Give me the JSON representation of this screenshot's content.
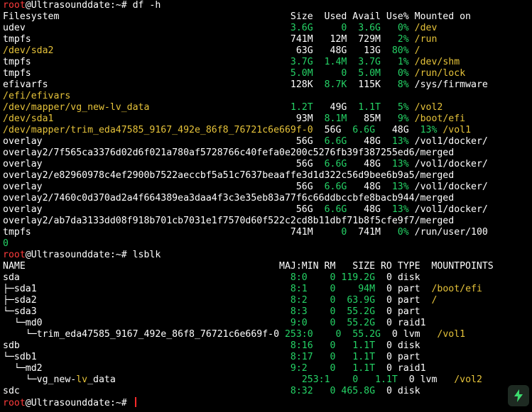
{
  "colors": {
    "default": "#ffffff",
    "user": "#ff3b3b",
    "host": "#ffffff",
    "green": "#25d366",
    "yellow": "#e6c33a",
    "cursor": "#ff2a2a",
    "badge_icon": "#3ddc6e"
  },
  "icons": {
    "bolt": "lightning-bolt-icon"
  },
  "lines": [
    [
      {
        "t": "root",
        "c": "user"
      },
      {
        "t": "@Ultrasounddate:~# df -h",
        "c": "host"
      }
    ],
    [
      {
        "t": "Filesystem                                         Size  Used Avail Use% Mounted on",
        "c": "default"
      }
    ],
    [
      {
        "t": "udev                                               ",
        "c": "default"
      },
      {
        "t": "3.6G",
        "c": "green"
      },
      {
        "t": "     ",
        "c": "default"
      },
      {
        "t": "0",
        "c": "green"
      },
      {
        "t": "  ",
        "c": "default"
      },
      {
        "t": "3.6G",
        "c": "green"
      },
      {
        "t": "   ",
        "c": "default"
      },
      {
        "t": "0%",
        "c": "green"
      },
      {
        "t": " ",
        "c": "default"
      },
      {
        "t": "/dev",
        "c": "yellow"
      }
    ],
    [
      {
        "t": "tmpfs                                              741M   12M  729M   ",
        "c": "default"
      },
      {
        "t": "2%",
        "c": "green"
      },
      {
        "t": " ",
        "c": "default"
      },
      {
        "t": "/run",
        "c": "yellow"
      }
    ],
    [
      {
        "t": "/dev/sda2",
        "c": "yellow"
      },
      {
        "t": "                                           63G   48G   13G  ",
        "c": "default"
      },
      {
        "t": "80%",
        "c": "green"
      },
      {
        "t": " ",
        "c": "default"
      },
      {
        "t": "/",
        "c": "yellow"
      }
    ],
    [
      {
        "t": "tmpfs                                              ",
        "c": "default"
      },
      {
        "t": "3.7G",
        "c": "green"
      },
      {
        "t": "  ",
        "c": "default"
      },
      {
        "t": "1.4M",
        "c": "green"
      },
      {
        "t": "  ",
        "c": "default"
      },
      {
        "t": "3.7G",
        "c": "green"
      },
      {
        "t": "   ",
        "c": "default"
      },
      {
        "t": "1%",
        "c": "green"
      },
      {
        "t": " ",
        "c": "default"
      },
      {
        "t": "/dev/shm",
        "c": "yellow"
      }
    ],
    [
      {
        "t": "tmpfs                                              ",
        "c": "default"
      },
      {
        "t": "5.0M",
        "c": "green"
      },
      {
        "t": "     ",
        "c": "default"
      },
      {
        "t": "0",
        "c": "green"
      },
      {
        "t": "  ",
        "c": "default"
      },
      {
        "t": "5.0M",
        "c": "green"
      },
      {
        "t": "   ",
        "c": "default"
      },
      {
        "t": "0%",
        "c": "green"
      },
      {
        "t": " ",
        "c": "default"
      },
      {
        "t": "/run/lock",
        "c": "yellow"
      }
    ],
    [
      {
        "t": "efivarfs                                           128K  ",
        "c": "default"
      },
      {
        "t": "8.7K",
        "c": "green"
      },
      {
        "t": "  115K   ",
        "c": "default"
      },
      {
        "t": "8%",
        "c": "green"
      },
      {
        "t": " /sys/firmware",
        "c": "default"
      }
    ],
    [
      {
        "t": "/efi/efivars",
        "c": "yellow"
      }
    ],
    [
      {
        "t": "/dev/mapper/vg_new-lv_data",
        "c": "yellow"
      },
      {
        "t": "                         ",
        "c": "default"
      },
      {
        "t": "1.2T",
        "c": "green"
      },
      {
        "t": "   49G  ",
        "c": "default"
      },
      {
        "t": "1.1T",
        "c": "green"
      },
      {
        "t": "   ",
        "c": "default"
      },
      {
        "t": "5%",
        "c": "green"
      },
      {
        "t": " ",
        "c": "default"
      },
      {
        "t": "/vol2",
        "c": "yellow"
      }
    ],
    [
      {
        "t": "/dev/sda1",
        "c": "yellow"
      },
      {
        "t": "                                           93M  ",
        "c": "default"
      },
      {
        "t": "8.1M",
        "c": "green"
      },
      {
        "t": "   85M   ",
        "c": "default"
      },
      {
        "t": "9%",
        "c": "green"
      },
      {
        "t": " ",
        "c": "default"
      },
      {
        "t": "/boot/efi",
        "c": "yellow"
      }
    ],
    [
      {
        "t": "/dev/mapper/trim_eda47585_9167_492e_86f8_76721c6e669f-0",
        "c": "yellow"
      },
      {
        "t": "  56G  ",
        "c": "default"
      },
      {
        "t": "6.6G",
        "c": "green"
      },
      {
        "t": "   48G  ",
        "c": "default"
      },
      {
        "t": "13%",
        "c": "green"
      },
      {
        "t": " ",
        "c": "default"
      },
      {
        "t": "/vol1",
        "c": "yellow"
      }
    ],
    [
      {
        "t": "overlay                                             56G  ",
        "c": "default"
      },
      {
        "t": "6.6G",
        "c": "green"
      },
      {
        "t": "   48G  ",
        "c": "default"
      },
      {
        "t": "13%",
        "c": "green"
      },
      {
        "t": " /vol1/docker/",
        "c": "default"
      }
    ],
    [
      {
        "t": "overlay2/7f565ca3376d02d6f021a780af5728766c40fefa0e200c5276fb39f387255ed6/merged",
        "c": "default"
      }
    ],
    [
      {
        "t": "overlay                                             56G  ",
        "c": "default"
      },
      {
        "t": "6.6G",
        "c": "green"
      },
      {
        "t": "   48G  ",
        "c": "default"
      },
      {
        "t": "13%",
        "c": "green"
      },
      {
        "t": " /vol1/docker/",
        "c": "default"
      }
    ],
    [
      {
        "t": "overlay2/e82960978c4ef2900b7522aeccbf5a51c7637beaaffe3d1d322c56d9bee6b9a5/merged",
        "c": "default"
      }
    ],
    [
      {
        "t": "overlay                                             56G  ",
        "c": "default"
      },
      {
        "t": "6.6G",
        "c": "green"
      },
      {
        "t": "   48G  ",
        "c": "default"
      },
      {
        "t": "13%",
        "c": "green"
      },
      {
        "t": " /vol1/docker/",
        "c": "default"
      }
    ],
    [
      {
        "t": "overlay2/7460c0d370ad2a4f664389ea3daa4f3c3e35eb83a77f6c66ddbccbfe8bacb944/merged",
        "c": "default"
      }
    ],
    [
      {
        "t": "overlay                                             56G  ",
        "c": "default"
      },
      {
        "t": "6.6G",
        "c": "green"
      },
      {
        "t": "   48G  ",
        "c": "default"
      },
      {
        "t": "13%",
        "c": "green"
      },
      {
        "t": " /vol1/docker/",
        "c": "default"
      }
    ],
    [
      {
        "t": "overlay2/ab7da3133dd08f918b701cb7031e1f7570d60f522c2cd8b11dbf71b8f5cfe9f7/merged",
        "c": "default"
      }
    ],
    [
      {
        "t": "tmpfs                                              741M     ",
        "c": "default"
      },
      {
        "t": "0",
        "c": "green"
      },
      {
        "t": "  741M   ",
        "c": "default"
      },
      {
        "t": "0%",
        "c": "green"
      },
      {
        "t": " /run/user/100",
        "c": "default"
      }
    ],
    [
      {
        "t": "0",
        "c": "green"
      }
    ],
    [
      {
        "t": "root",
        "c": "user"
      },
      {
        "t": "@Ultrasounddate:~# lsblk",
        "c": "host"
      }
    ],
    [
      {
        "t": "NAME                                             MAJ:MIN RM   SIZE RO TYPE  MOUNTPOINTS",
        "c": "default"
      }
    ],
    [
      {
        "t": "sda                                                ",
        "c": "default"
      },
      {
        "t": "8:0",
        "c": "green"
      },
      {
        "t": "    ",
        "c": "default"
      },
      {
        "t": "0",
        "c": "green"
      },
      {
        "t": " ",
        "c": "default"
      },
      {
        "t": "119.2G",
        "c": "green"
      },
      {
        "t": "  0 disk",
        "c": "default"
      }
    ],
    [
      {
        "t": "├─sda1                                             ",
        "c": "default"
      },
      {
        "t": "8:1",
        "c": "green"
      },
      {
        "t": "    ",
        "c": "default"
      },
      {
        "t": "0",
        "c": "green"
      },
      {
        "t": "    ",
        "c": "default"
      },
      {
        "t": "94M",
        "c": "green"
      },
      {
        "t": "  0 part  ",
        "c": "default"
      },
      {
        "t": "/boot/efi",
        "c": "yellow"
      }
    ],
    [
      {
        "t": "├─sda2                                             ",
        "c": "default"
      },
      {
        "t": "8:2",
        "c": "green"
      },
      {
        "t": "    ",
        "c": "default"
      },
      {
        "t": "0",
        "c": "green"
      },
      {
        "t": "  ",
        "c": "default"
      },
      {
        "t": "63.9G",
        "c": "green"
      },
      {
        "t": "  0 part  ",
        "c": "default"
      },
      {
        "t": "/",
        "c": "yellow"
      }
    ],
    [
      {
        "t": "└─sda3                                             ",
        "c": "default"
      },
      {
        "t": "8:3",
        "c": "green"
      },
      {
        "t": "    ",
        "c": "default"
      },
      {
        "t": "0",
        "c": "green"
      },
      {
        "t": "  ",
        "c": "default"
      },
      {
        "t": "55.2G",
        "c": "green"
      },
      {
        "t": "  0 part",
        "c": "default"
      }
    ],
    [
      {
        "t": "  └─md0                                            ",
        "c": "default"
      },
      {
        "t": "9:0",
        "c": "green"
      },
      {
        "t": "    ",
        "c": "default"
      },
      {
        "t": "0",
        "c": "green"
      },
      {
        "t": "  ",
        "c": "default"
      },
      {
        "t": "55.2G",
        "c": "green"
      },
      {
        "t": "  0 raid1",
        "c": "default"
      }
    ],
    [
      {
        "t": "    └─trim_eda47585_9167_492e_86f8_76721c6e669f-0 ",
        "c": "default"
      },
      {
        "t": "253:0",
        "c": "green"
      },
      {
        "t": "    ",
        "c": "default"
      },
      {
        "t": "0",
        "c": "green"
      },
      {
        "t": "  ",
        "c": "default"
      },
      {
        "t": "55.2G",
        "c": "green"
      },
      {
        "t": "  0 lvm   ",
        "c": "default"
      },
      {
        "t": "/vol1",
        "c": "yellow"
      }
    ],
    [
      {
        "t": "sdb                                                ",
        "c": "default"
      },
      {
        "t": "8:16",
        "c": "green"
      },
      {
        "t": "   ",
        "c": "default"
      },
      {
        "t": "0",
        "c": "green"
      },
      {
        "t": "   ",
        "c": "default"
      },
      {
        "t": "1.1T",
        "c": "green"
      },
      {
        "t": "  0 disk",
        "c": "default"
      }
    ],
    [
      {
        "t": "└─sdb1                                             ",
        "c": "default"
      },
      {
        "t": "8:17",
        "c": "green"
      },
      {
        "t": "   ",
        "c": "default"
      },
      {
        "t": "0",
        "c": "green"
      },
      {
        "t": "   ",
        "c": "default"
      },
      {
        "t": "1.1T",
        "c": "green"
      },
      {
        "t": "  0 part",
        "c": "default"
      }
    ],
    [
      {
        "t": "  └─md2                                            ",
        "c": "default"
      },
      {
        "t": "9:2",
        "c": "green"
      },
      {
        "t": "    ",
        "c": "default"
      },
      {
        "t": "0",
        "c": "green"
      },
      {
        "t": "   ",
        "c": "default"
      },
      {
        "t": "1.1T",
        "c": "green"
      },
      {
        "t": "  0 raid1",
        "c": "default"
      }
    ],
    [
      {
        "t": "    └─vg_new-",
        "c": "default"
      },
      {
        "t": "lv",
        "c": "yellow"
      },
      {
        "t": "_data                                 ",
        "c": "default"
      },
      {
        "t": "253:1",
        "c": "green"
      },
      {
        "t": "    ",
        "c": "default"
      },
      {
        "t": "0",
        "c": "green"
      },
      {
        "t": "   ",
        "c": "default"
      },
      {
        "t": "1.1T",
        "c": "green"
      },
      {
        "t": "  0 lvm   ",
        "c": "default"
      },
      {
        "t": "/vol2",
        "c": "yellow"
      }
    ],
    [
      {
        "t": "sdc                                                ",
        "c": "default"
      },
      {
        "t": "8:32",
        "c": "green"
      },
      {
        "t": "   ",
        "c": "default"
      },
      {
        "t": "0",
        "c": "green"
      },
      {
        "t": " ",
        "c": "default"
      },
      {
        "t": "465.8G",
        "c": "green"
      },
      {
        "t": "  0 disk",
        "c": "default"
      }
    ],
    [
      {
        "t": "root",
        "c": "user"
      },
      {
        "t": "@Ultrasounddate:~# ",
        "c": "host"
      }
    ]
  ]
}
